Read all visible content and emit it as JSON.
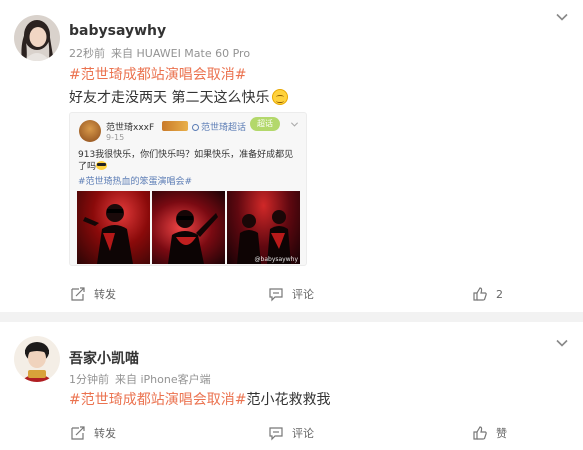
{
  "posts": [
    {
      "username": "babysaywhy",
      "time": "22秒前",
      "source": "来自 HUAWEI Mate 60 Pro",
      "hashtag": "#范世琦成都站演唱会取消#",
      "hashtag_suffix": "",
      "content": "好友才走没两天 第二天这么快乐",
      "repost": {
        "author": "范世琦xxxF",
        "super_topic": "范世琦超话",
        "date": "9-15",
        "tag": "超话",
        "text": "913我很快乐，你们快乐吗？如果快乐，准备好成都见了吗",
        "hashtag": "#范世琦热血的笨蛋演唱会#",
        "watermark": "@babysaywhy",
        "photos": [
          "concert-photo-1",
          "concert-photo-2",
          "concert-photo-3"
        ]
      },
      "actions": {
        "forward": "转发",
        "comment": "评论",
        "like": "2"
      }
    },
    {
      "username": "吾家小凯喵",
      "time": "1分钟前",
      "source": "来自 iPhone客户端",
      "hashtag": "#范世琦成都站演唱会取消#",
      "hashtag_suffix": "范小花救救我",
      "actions": {
        "forward": "转发",
        "comment": "评论",
        "like": "赞"
      }
    }
  ],
  "icons": {
    "chevron": "chevron-down-icon",
    "forward": "forward-icon",
    "comment": "comment-icon",
    "like": "thumbs-up-icon"
  },
  "colors": {
    "hashtag": "#eb7350",
    "link_blue": "#5b7cb5",
    "meta_gray": "#939393",
    "separator": "#f2f2f2"
  }
}
